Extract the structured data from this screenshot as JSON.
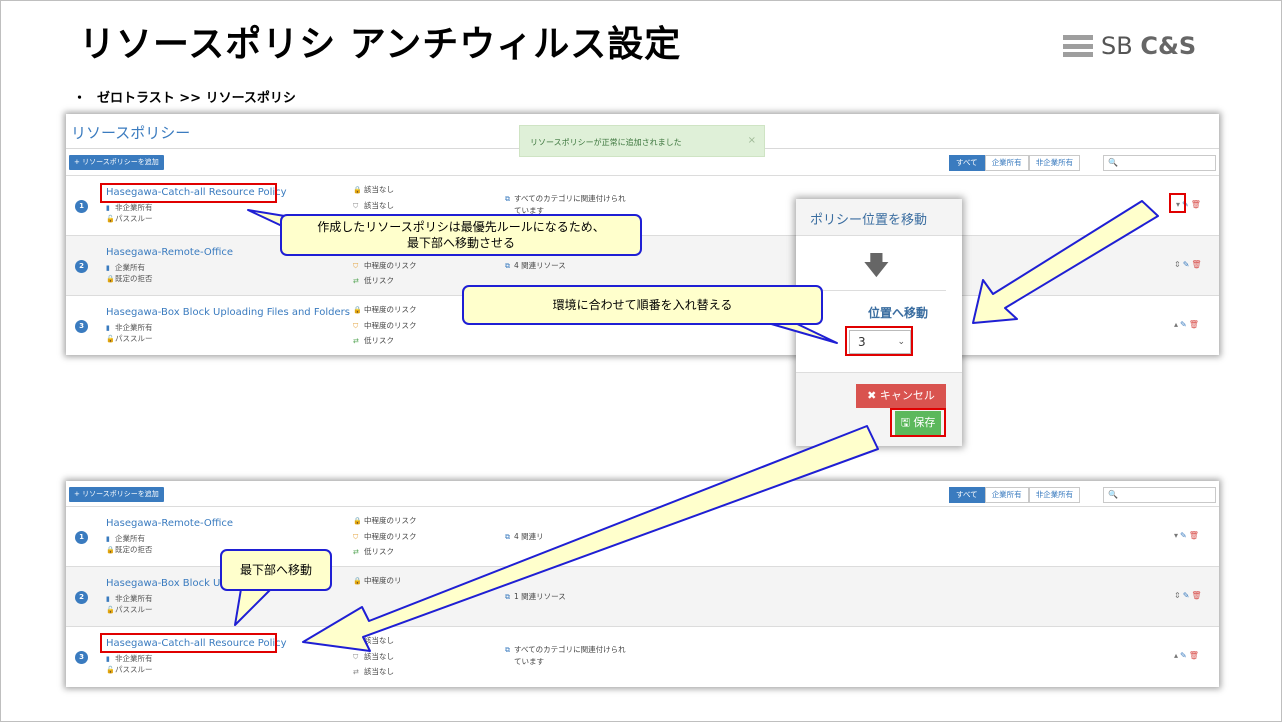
{
  "slide": {
    "title": "リソースポリシ アンチウィルス設定",
    "logo": {
      "part1": "SB ",
      "part2": "C&S"
    },
    "breadcrumb_bullet": "・",
    "breadcrumb": "ゼロトラスト >> リソースポリシ"
  },
  "app": {
    "panel_title": "リソースポリシー",
    "toast": "リソースポリシーが正常に追加されました",
    "toast_close": "×",
    "add_button": "+ リソースポリシーを追加",
    "filters": [
      "すべて",
      "企業所有",
      "非企業所有"
    ],
    "search_icon": "🔍"
  },
  "top_rows": [
    {
      "num": "1",
      "name": "Hasegawa-Catch-all Resource Policy",
      "owner": "非企業所有",
      "access": "パススルー",
      "risk": [
        "該当なし",
        "該当なし",
        ""
      ],
      "assoc": [
        "すべてのカテゴリに関連付けられ",
        "ています"
      ],
      "move": "▾"
    },
    {
      "num": "2",
      "name": "Hasegawa-Remote-Office",
      "owner": "企業所有",
      "access": "既定の拒否",
      "risk": [
        "",
        "中程度のリスク",
        "低リスク"
      ],
      "assoc": [
        "4 関連リソース"
      ],
      "move": "⇕"
    },
    {
      "num": "3",
      "name": "Hasegawa-Box Block Uploading Files and Folders",
      "owner": "非企業所有",
      "access": "パススルー",
      "risk": [
        "中程度のリスク",
        "中程度のリスク",
        "低リスク"
      ],
      "assoc": [],
      "move": "▴"
    }
  ],
  "bottom_rows": [
    {
      "num": "1",
      "name": "Hasegawa-Remote-Office",
      "owner": "企業所有",
      "access": "既定の拒否",
      "risk": [
        "中程度のリスク",
        "中程度のリスク",
        "低リスク"
      ],
      "assoc": [
        "4 関連リ"
      ],
      "move": "▾"
    },
    {
      "num": "2",
      "name": "Hasegawa-Box Block Uplo",
      "owner": "非企業所有",
      "access": "パススルー",
      "risk": [
        "中程度のリ",
        "",
        ""
      ],
      "assoc": [
        "1 関連リソース"
      ],
      "move": "⇕"
    },
    {
      "num": "3",
      "name": "Hasegawa-Catch-all Resource Policy",
      "owner": "非企業所有",
      "access": "パススルー",
      "risk": [
        "該当なし",
        "該当なし",
        "該当なし"
      ],
      "assoc": [
        "すべてのカテゴリに関連付けられ",
        "ています"
      ],
      "move": "▴"
    }
  ],
  "dialog": {
    "title": "ポリシー位置を移動",
    "arrow": "🡇",
    "label": "位置へ移動",
    "selected": "3",
    "cancel": "✖ キャンセル",
    "save": "🖫 保存"
  },
  "callouts": {
    "c1_line1": "作成したリソースポリシは最優先ルールになるため、",
    "c1_line2": "最下部へ移動させる",
    "c2": "環境に合わせて順番を入れ替える",
    "c3": "最下部へ移動"
  },
  "colors": {
    "accent": "#3a7bbf",
    "highlight_red": "#e00000",
    "callout_fill": "#ffffcc",
    "callout_border": "#1f1fd4",
    "arrow_fill": "#ffffcc",
    "cancel": "#d9534f",
    "save": "#5cb85c"
  }
}
